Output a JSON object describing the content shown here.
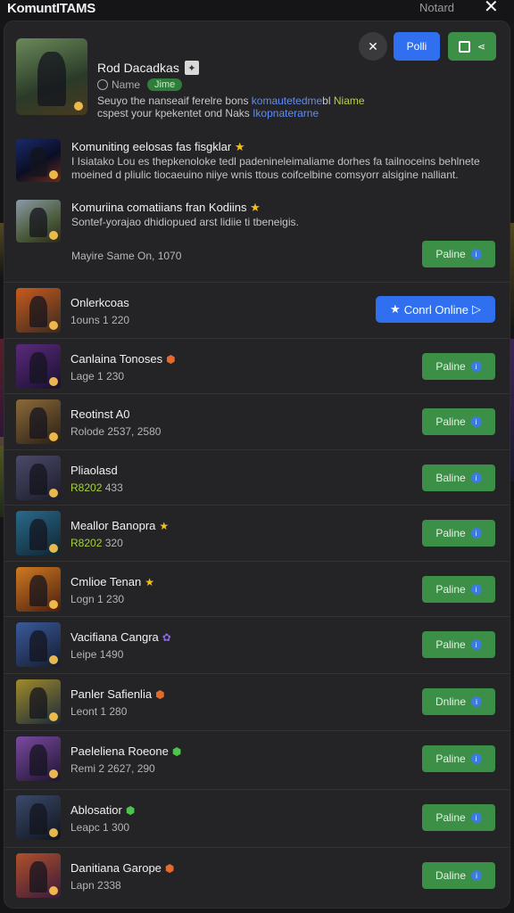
{
  "topbar": {
    "title": "KomuntITAMS",
    "status": "Notard",
    "close_icon": "close-icon"
  },
  "header": {
    "name": "Rod Dacadkas",
    "meta_label": "Name",
    "tag": "Jime",
    "desc_line1_a": "Seuyo the nanseaif ferelre bons ",
    "desc_line1_link": "komautetedme",
    "desc_line1_b": "bl ",
    "desc_line1_hl": "Niame",
    "desc_line2_a": "cspest your kpekentet ond Naks ",
    "desc_line2_link": "Ikopnaterarne",
    "buttons": {
      "close_round": "✕",
      "primary": "Polli"
    }
  },
  "posts": [
    {
      "title": "Komuniting eelosas fas fisgklar",
      "text": "I Isiatako Lou es thepkenoloke tedl padenineleimaliame dorhes fa tailnoceins behlnete moeined d pliulic tiocaeuino niiye wnis ttous coifcelbine comsyorr alsigine nalliant."
    },
    {
      "title": "Komuriina comatiians fran Kodiins",
      "text": "Sontef-yorajao dhidiopued arst lidiie ti tbeneigis."
    }
  ],
  "footer_note": "Mayire Same On, 1070",
  "footer_button": "Paline",
  "list": [
    {
      "name": "Onlerkcoas",
      "sub": "1ouns 1 220",
      "emblem": "",
      "button": "Conrl Online",
      "button_style": "blue",
      "art": [
        "#c85a1c",
        "#3a2a20"
      ]
    },
    {
      "name": "Canlaina Tonoses",
      "sub": "Lage 1 230",
      "emblem": "orange",
      "button": "Paline",
      "art": [
        "#5a2a7a",
        "#1a1030"
      ]
    },
    {
      "name": "Reotinst A0",
      "sub": "Rolode 2537, 2580",
      "emblem": "",
      "button": "Paline",
      "art": [
        "#8a6a3a",
        "#2a1e14"
      ]
    },
    {
      "name": "Pliaolasd",
      "sub_hl": "R8202",
      "sub": "433",
      "emblem": "",
      "button": "Baline",
      "art": [
        "#4a4a6a",
        "#1c1c2a"
      ]
    },
    {
      "name": "Meallor Banopra",
      "sub_hl": "R8202",
      "sub": "320",
      "emblem": "gold",
      "button": "Paline",
      "art": [
        "#2a6a8a",
        "#0e2430"
      ]
    },
    {
      "name": "Cmlioe Tenan",
      "sub": "Logn 1 230",
      "emblem": "gold",
      "button": "Paline",
      "art": [
        "#d07a22",
        "#4a1e0e"
      ]
    },
    {
      "name": "Vacifiana Cangra",
      "sub": "Leipe 1490",
      "emblem": "purple",
      "button": "Paline",
      "art": [
        "#3a5a9a",
        "#141c30"
      ]
    },
    {
      "name": "Panler Safienlia",
      "sub": "Leont 1 280",
      "emblem": "orange",
      "button": "Dnline",
      "art": [
        "#a08a2a",
        "#1a2a3a"
      ]
    },
    {
      "name": "Paeleliena Roeone",
      "sub": "Remi 2 2627, 290",
      "emblem": "green",
      "button": "Paline",
      "art": [
        "#7a4aa0",
        "#1e1430"
      ]
    },
    {
      "name": "Ablosatior",
      "sub": "Leapc 1 300",
      "emblem": "green",
      "button": "Paline",
      "art": [
        "#3a4a6a",
        "#10141e"
      ]
    },
    {
      "name": "Danitiana Garope",
      "sub": "Lapn 2338",
      "emblem": "orange",
      "button": "Daline",
      "art": [
        "#b0502a",
        "#3a1a3a"
      ]
    }
  ],
  "colors": {
    "accent_blue": "#2f6ff0",
    "accent_green": "#3c8f46",
    "panel": "#242426"
  }
}
